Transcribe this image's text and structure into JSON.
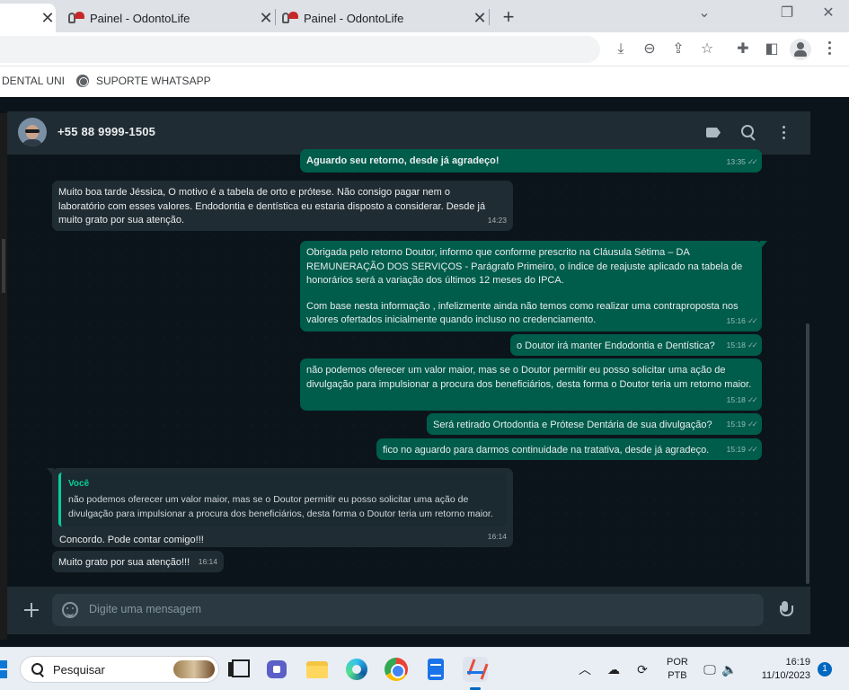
{
  "browser": {
    "tabs": [
      {
        "title": "",
        "close": "✕"
      },
      {
        "title": "Painel - OdontoLife",
        "close": "✕"
      },
      {
        "title": "Painel - OdontoLife",
        "close": "✕"
      }
    ],
    "new_tab": "+",
    "window_controls": {
      "minimize": "⌄",
      "restore": "❐",
      "close": "✕"
    },
    "toolbar_icons": [
      "install-icon",
      "zoom-out-icon",
      "share-icon",
      "bookmark-star-icon",
      "extensions-icon",
      "side-panel-icon",
      "profile-icon",
      "menu-icon"
    ]
  },
  "bookmarks": {
    "item1": "DENTAL UNI",
    "item2": "SUPORTE WHATSAPP"
  },
  "chat": {
    "contact_name": "+55 88 9999-1505",
    "messages": [
      {
        "dir": "out",
        "text": "Aguardo seu retorno, desde já agradeço!",
        "time": "13:35"
      },
      {
        "dir": "in",
        "text": "Muito boa tarde Jéssica, O motivo é a tabela de orto e prótese. Não consigo pagar nem o laboratório com esses valores. Endodontia e dentística eu estaria disposto a considerar. Desde já muito grato por sua atenção.",
        "time": "14:23"
      },
      {
        "dir": "out",
        "text": "Obrigada pelo retorno Doutor, informo que conforme prescrito na Cláusula Sétima – DA REMUNERAÇÃO DOS SERVIÇOS - Parágrafo Primeiro, o índice de reajuste aplicado na tabela de honorários será a variação dos últimos 12 meses do IPCA.",
        "text2": "Com base nesta informação , infelizmente ainda não temos como realizar uma contraproposta nos valores ofertados inicialmente quando incluso no credenciamento.",
        "time": "15:16"
      },
      {
        "dir": "out",
        "text": "o Doutor irá manter Endodontia e Dentística?",
        "time": "15:18"
      },
      {
        "dir": "out",
        "text": "não podemos oferecer um valor maior, mas se o Doutor permitir eu posso solicitar uma ação de divulgação para impulsionar a procura dos beneficiários, desta forma o Doutor teria um retorno maior.",
        "time": "15:18"
      },
      {
        "dir": "out",
        "text": "Será retirado Ortodontia e Prótese Dentária de sua divulgação?",
        "time": "15:19"
      },
      {
        "dir": "out",
        "text": "fico no aguardo para darmos continuidade na tratativa, desde já agradeço.",
        "time": "15:19"
      },
      {
        "dir": "in",
        "quote_author": "Você",
        "quote_text": "não podemos oferecer um valor maior, mas se o Doutor permitir eu posso solicitar uma ação de divulgação para impulsionar a procura dos beneficiários, desta forma o Doutor teria um retorno maior.",
        "text": "Concordo. Pode contar comigo!!!",
        "time": "16:14"
      },
      {
        "dir": "in",
        "text": "Muito grato por sua atenção!!!",
        "time": "16:14"
      }
    ],
    "composer_placeholder": "Digite uma mensagem"
  },
  "taskbar": {
    "search_label": "Pesquisar",
    "language_line1": "POR",
    "language_line2": "PTB",
    "time": "16:19",
    "date": "11/10/2023",
    "notification_count": "1",
    "tray_chevron": "︿"
  },
  "colors": {
    "outgoing_bubble": "#005c4b",
    "incoming_bubble": "#202c33",
    "chat_background": "#0b141a",
    "quote_accent": "#06cf9c"
  }
}
